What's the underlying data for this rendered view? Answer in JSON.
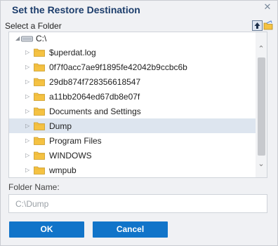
{
  "dialog": {
    "title": "Set the Restore Destination",
    "close_glyph": "✕",
    "select_label": "Select a Folder"
  },
  "toolbar": {
    "up_icon": "folder-up-icon",
    "new_folder_icon": "new-folder-icon"
  },
  "tree": {
    "root": {
      "label": "C:\\",
      "icon": "drive-icon",
      "expanded": true
    },
    "items": [
      {
        "label": "$uperdat.log",
        "selected": false
      },
      {
        "label": "0f7f0acc7ae9f1895fe42042b9ccbc6b",
        "selected": false
      },
      {
        "label": "29db874f728356618547",
        "selected": false
      },
      {
        "label": "a11bb2064ed67db8e07f",
        "selected": false
      },
      {
        "label": "Documents and Settings",
        "selected": false
      },
      {
        "label": "Dump",
        "selected": true
      },
      {
        "label": "Program Files",
        "selected": false
      },
      {
        "label": "WINDOWS",
        "selected": false
      },
      {
        "label": "wmpub",
        "selected": false
      }
    ]
  },
  "folder_name": {
    "label": "Folder Name:",
    "value": "C:\\Dump"
  },
  "buttons": {
    "ok": "OK",
    "cancel": "Cancel"
  },
  "colors": {
    "accent": "#1174c9",
    "title": "#1c3d6b",
    "selection": "#dde5ef",
    "folder": "#f5c242"
  }
}
